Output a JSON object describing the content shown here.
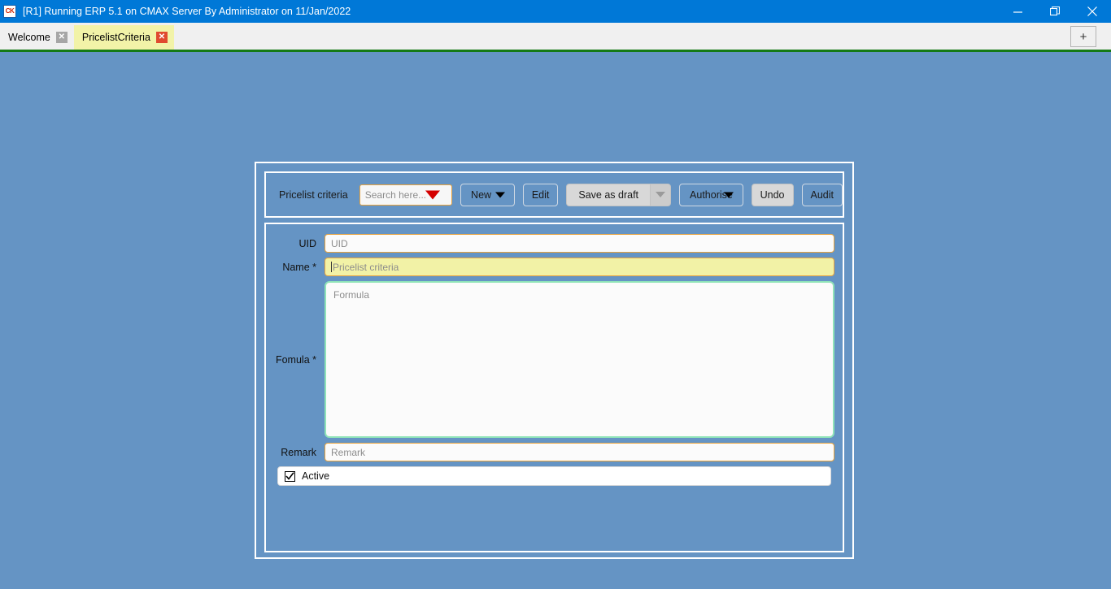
{
  "window": {
    "app_icon_text": "CK",
    "title": "[R1] Running ERP 5.1 on CMAX Server By Administrator on 11/Jan/2022",
    "accent_color": "#0078d7",
    "controls": [
      {
        "name": "minimize",
        "label": "—"
      },
      {
        "name": "restore",
        "label": "❐"
      },
      {
        "name": "close",
        "label": "✕"
      }
    ]
  },
  "tabbar": {
    "tabs": [
      {
        "label": "Welcome",
        "active": false,
        "close_label": "✕"
      },
      {
        "label": "PricelistCriteria",
        "active": true,
        "close_label": "✕"
      }
    ],
    "add_tab_label": "+",
    "active_tab_color": "#f2f3a8",
    "separator_color": "#157a15"
  },
  "workspace": {
    "background_color": "#6594c4"
  },
  "toolbar": {
    "module_label": "Pricelist criteria",
    "search": {
      "placeholder": "Search here...",
      "value": "",
      "border_color": "#e8a33d",
      "caret_color": "#d40000"
    },
    "buttons": [
      {
        "label": "New",
        "style": "flat",
        "has_dropdown": true
      },
      {
        "label": "Edit",
        "style": "flat",
        "has_dropdown": false
      },
      {
        "label": "Save as draft",
        "style": "split",
        "has_dropdown": true
      },
      {
        "label": "Authorise",
        "style": "flat",
        "has_dropdown": true
      },
      {
        "label": "Undo",
        "style": "grey",
        "has_dropdown": false
      },
      {
        "label": "Audit",
        "style": "flat",
        "has_dropdown": false
      }
    ]
  },
  "form": {
    "fields": [
      {
        "label": "UID",
        "placeholder": "UID",
        "value": "",
        "state": "normal"
      },
      {
        "label": "Name *",
        "placeholder": "Pricelist criteria",
        "value": "",
        "state": "focused"
      },
      {
        "label": "Fomula *",
        "placeholder": "Formula",
        "value": "",
        "state": "valid"
      },
      {
        "label": "Remark",
        "placeholder": "Remark",
        "value": "",
        "state": "normal"
      }
    ],
    "active_checkbox": {
      "label": "Active",
      "checked": true
    },
    "field_border_color": "#e8a33d",
    "focused_field_color": "#f2f2a6",
    "formula_border_color": "#8fe3b8"
  }
}
